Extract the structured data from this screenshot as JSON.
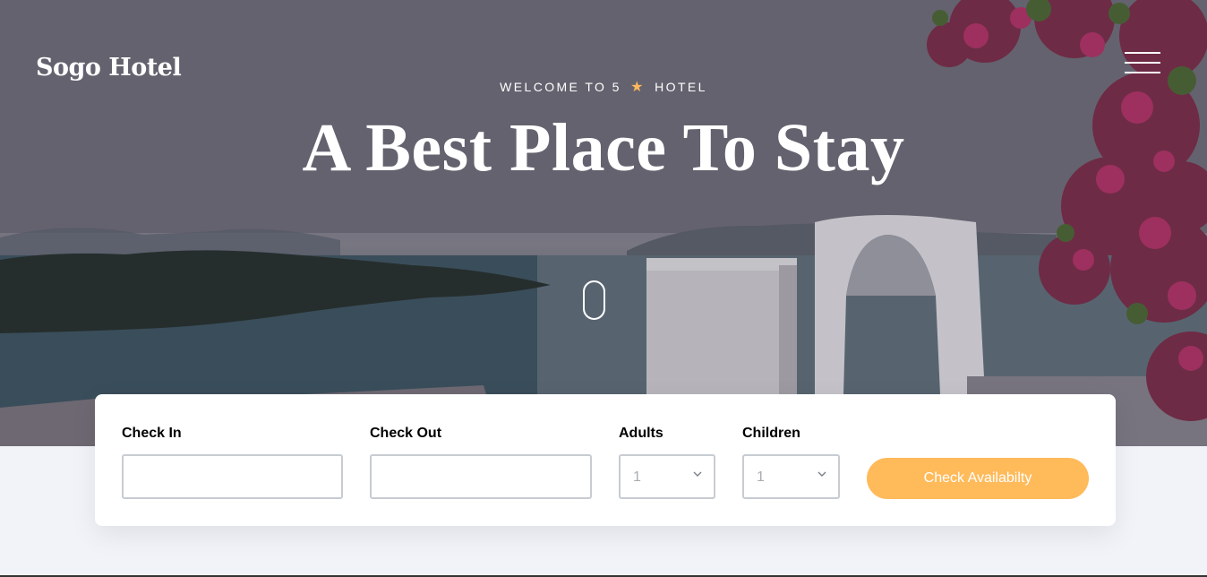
{
  "brand": {
    "name": "Sogo Hotel"
  },
  "hero": {
    "welcome_prefix": "WELCOME TO 5",
    "welcome_star": "★",
    "welcome_suffix": "HOTEL",
    "headline": "A Best Place To Stay"
  },
  "icons": {
    "menu": "hamburger-menu-icon",
    "star": "star-icon",
    "scroll": "scroll-mouse-icon",
    "chevron": "chevron-down-icon"
  },
  "booking": {
    "check_in": {
      "label": "Check In",
      "value": ""
    },
    "check_out": {
      "label": "Check Out",
      "value": ""
    },
    "adults": {
      "label": "Adults",
      "selected": "1"
    },
    "children": {
      "label": "Children",
      "selected": "1"
    },
    "submit_label": "Check Availabilty"
  },
  "colors": {
    "accent": "#ffba5a",
    "star": "#ffb85c",
    "page_bg": "#f1f3f9",
    "input_border": "#c7ccd1"
  }
}
